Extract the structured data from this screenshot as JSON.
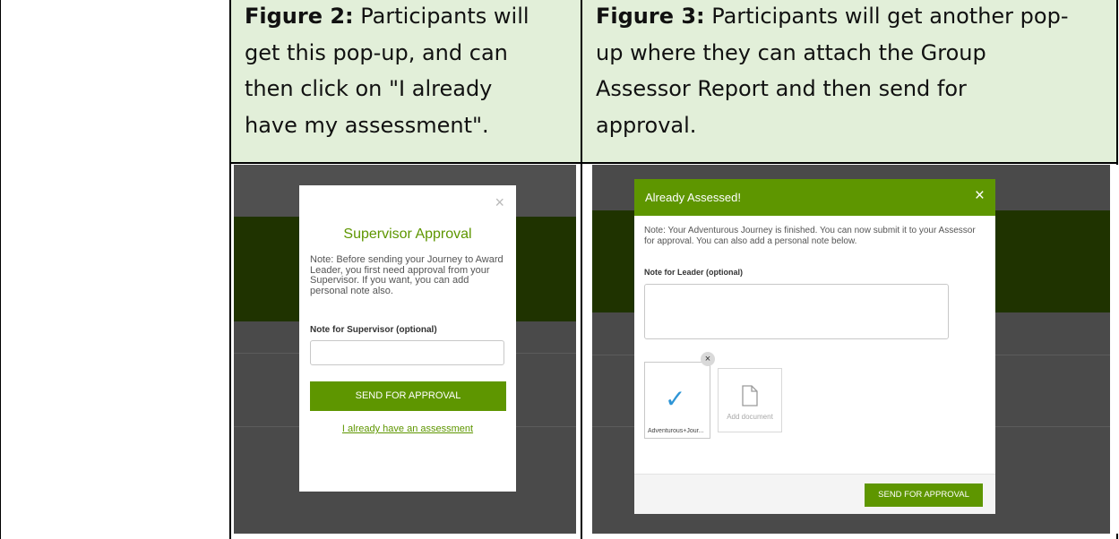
{
  "figure2": {
    "caption_label": "Figure 2:",
    "caption_lines": [
      " Participants will",
      "get this pop-up, and can",
      "then click on \"I already",
      "have my assessment\"."
    ],
    "modal": {
      "close_glyph": "×",
      "title": "Supervisor Approval",
      "note": "Note: Before sending your Journey to Award Leader, you first need approval from your Supervisor. If you want, you can add personal note also.",
      "field_label": "Note for Supervisor (optional)",
      "field_value": "",
      "button_label": "SEND FOR APPROVAL",
      "link_label": "I already have an assessment"
    }
  },
  "figure3": {
    "caption_label": "Figure 3:",
    "caption_lines": [
      " Participants will get another pop-",
      "up where they can attach the Group",
      "Assessor Report and then send for",
      "approval."
    ],
    "modal": {
      "title": "Already Assessed!",
      "close_glyph": "×",
      "note": "Note: Your Adventurous Journey is finished. You can now submit it to your Assessor for approval. You can also add a personal note below.",
      "field_label": "Note for Leader (optional)",
      "field_value": "",
      "attachment": {
        "file_name": "Adventurous+Jour...",
        "remove_glyph": "×",
        "check_glyph": "✓"
      },
      "add_document_label": "Add document",
      "button_label": "SEND FOR APPROVAL"
    }
  },
  "colors": {
    "caption_background": "#e2efd9",
    "brand_green": "#5e9600",
    "dark_green_band": "#1f3300",
    "overlay_grey": "#4a4a4a",
    "check_blue": "#2e95d6"
  },
  "icons": [
    "close-icon",
    "check-icon",
    "document-icon",
    "remove-icon"
  ]
}
